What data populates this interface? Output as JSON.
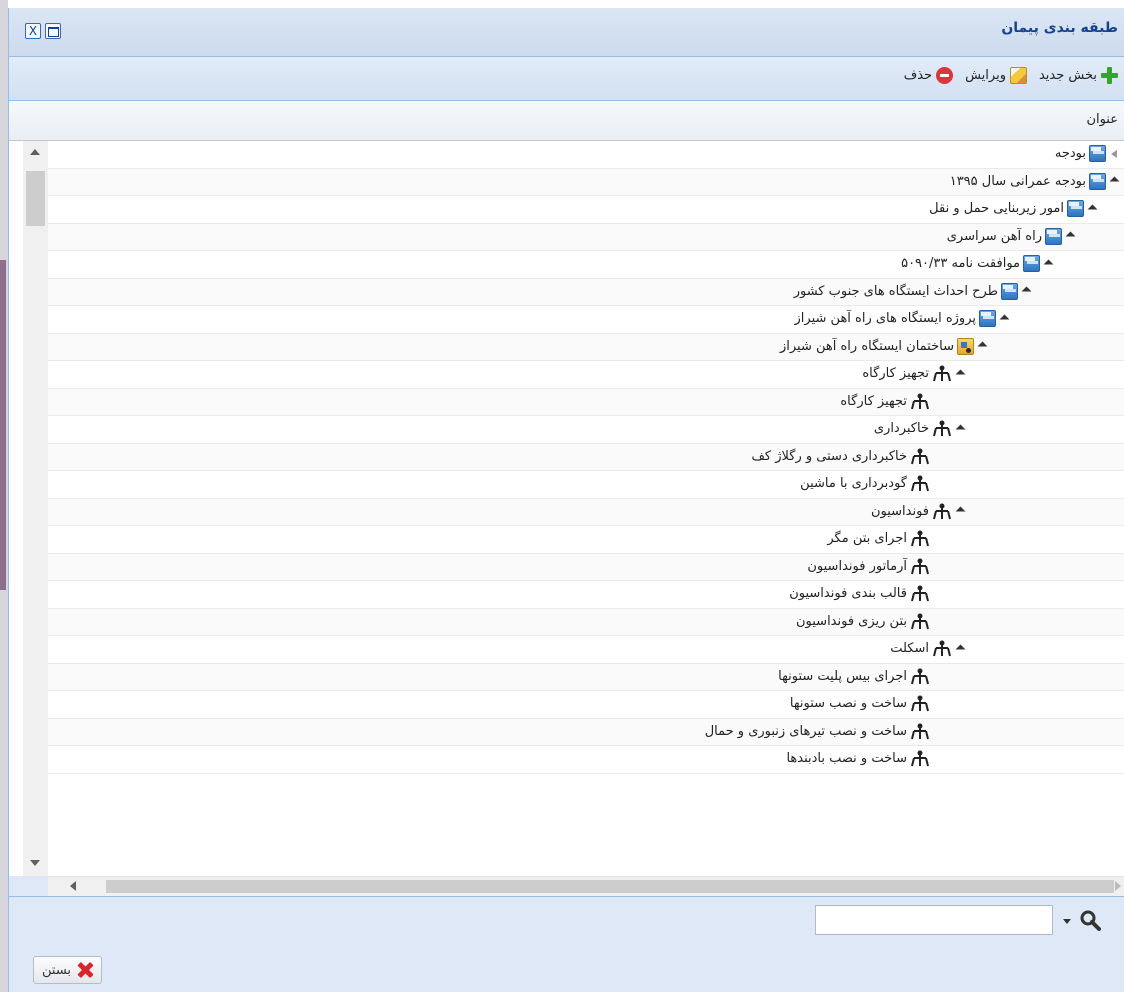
{
  "window": {
    "title": "طبقه بندی پیمان",
    "close_glyph": "X"
  },
  "toolbar": {
    "add_label": "بخش جدید",
    "edit_label": "ویرایش",
    "delete_label": "حذف"
  },
  "grid": {
    "column_header": "عنوان",
    "rows": [
      {
        "label": "بودجه",
        "icon": "folder-icon",
        "expander": "collapsed",
        "indent": 0
      },
      {
        "label": "بودجه عمرانی سال ۱۳۹۵",
        "icon": "folder-icon",
        "expander": "expanded",
        "indent": 0
      },
      {
        "label": "امور زیربنایی حمل و نقل",
        "icon": "folder-icon",
        "expander": "expanded",
        "indent": 1
      },
      {
        "label": "راه آهن سراسری",
        "icon": "folder-icon",
        "expander": "expanded",
        "indent": 2
      },
      {
        "label": "موافقت نامه ۵۰۹۰/۳۳",
        "icon": "folder-icon",
        "expander": "expanded",
        "indent": 3
      },
      {
        "label": "طرح احداث ایستگاه های جنوب کشور",
        "icon": "folder-icon",
        "expander": "expanded",
        "indent": 4
      },
      {
        "label": "پروژه ایستگاه های راه آهن شیراز",
        "icon": "folder-icon",
        "expander": "expanded",
        "indent": 5
      },
      {
        "label": "ساختمان ایستگاه راه آهن شیراز",
        "icon": "building-icon",
        "expander": "expanded",
        "indent": 6
      },
      {
        "label": "تجهیز کارگاه",
        "icon": "hierarchy-icon",
        "expander": "expanded",
        "indent": 7
      },
      {
        "label": "تجهیز کارگاه",
        "icon": "hierarchy-icon",
        "expander": "none",
        "indent": 8
      },
      {
        "label": "خاکبرداری",
        "icon": "hierarchy-icon",
        "expander": "expanded",
        "indent": 7
      },
      {
        "label": "خاکبرداری دستی و رگلاژ کف",
        "icon": "hierarchy-icon",
        "expander": "none",
        "indent": 8
      },
      {
        "label": "گودبرداری با ماشین",
        "icon": "hierarchy-icon",
        "expander": "none",
        "indent": 8
      },
      {
        "label": "فونداسیون",
        "icon": "hierarchy-icon",
        "expander": "expanded",
        "indent": 7
      },
      {
        "label": "اجرای بتن مگر",
        "icon": "hierarchy-icon",
        "expander": "none",
        "indent": 8
      },
      {
        "label": "آرماتور فونداسیون",
        "icon": "hierarchy-icon",
        "expander": "none",
        "indent": 8
      },
      {
        "label": "قالب بندی فونداسیون",
        "icon": "hierarchy-icon",
        "expander": "none",
        "indent": 8
      },
      {
        "label": "بتن ریزی فونداسیون",
        "icon": "hierarchy-icon",
        "expander": "none",
        "indent": 8
      },
      {
        "label": "اسکلت",
        "icon": "hierarchy-icon",
        "expander": "expanded",
        "indent": 7
      },
      {
        "label": "اجرای بیس پلیت ستونها",
        "icon": "hierarchy-icon",
        "expander": "none",
        "indent": 8
      },
      {
        "label": "ساخت و نصب ستونها",
        "icon": "hierarchy-icon",
        "expander": "none",
        "indent": 8
      },
      {
        "label": "ساخت و نصب تیرهای زنبوری و حمال",
        "icon": "hierarchy-icon",
        "expander": "none",
        "indent": 8
      },
      {
        "label": "ساخت و نصب بادبندها",
        "icon": "hierarchy-icon",
        "expander": "none",
        "indent": 8
      }
    ]
  },
  "search": {
    "value": "",
    "placeholder": ""
  },
  "footer": {
    "close_label": "بستن"
  },
  "colors": {
    "window_bg": "#dfe8f6",
    "title_text": "#15428b",
    "border": "#99bbe8",
    "add_icon": "#37a32a",
    "delete_icon": "#d9363e",
    "close_icon": "#d9252c"
  }
}
